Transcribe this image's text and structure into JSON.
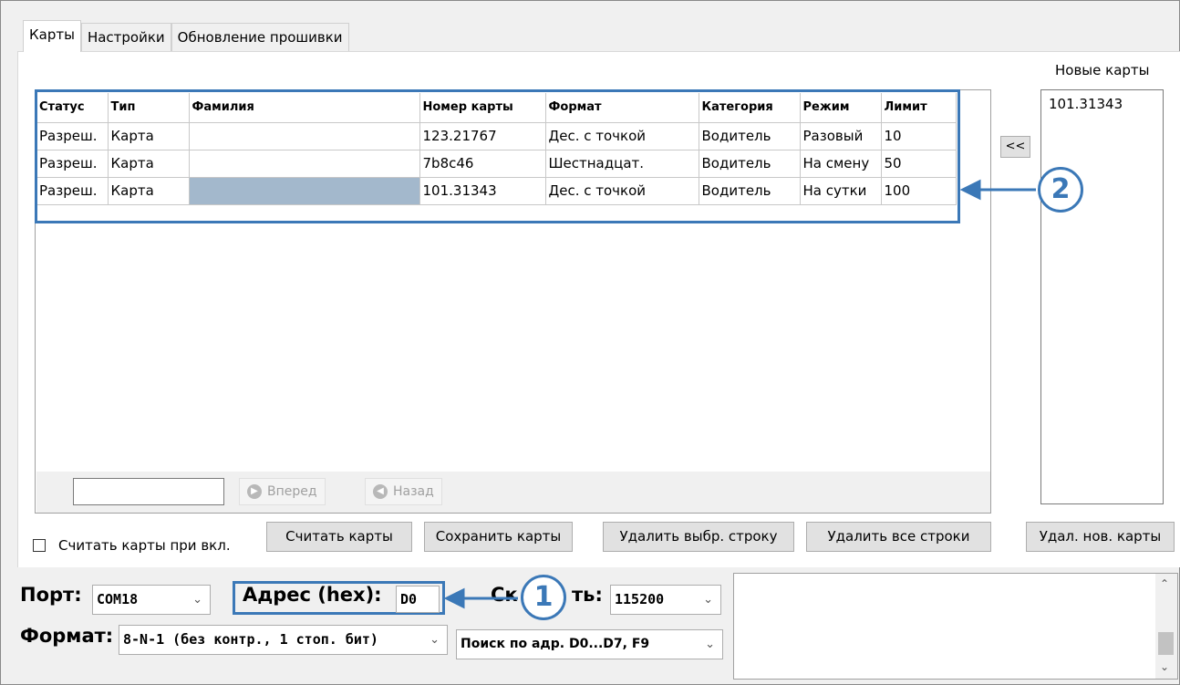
{
  "tabs": [
    {
      "label": "Карты",
      "active": true
    },
    {
      "label": "Настройки",
      "active": false
    },
    {
      "label": "Обновление прошивки",
      "active": false
    }
  ],
  "table": {
    "columns": [
      "Статус",
      "Тип",
      "Фамилия",
      "Номер карты",
      "Формат",
      "Категория",
      "Режим",
      "Лимит"
    ],
    "rows": [
      [
        "Разреш.",
        "Карта",
        "",
        "123.21767",
        "Дес. с точкой",
        "Водитель",
        "Разовый",
        "10"
      ],
      [
        "Разреш.",
        "Карта",
        "",
        "7b8c46",
        "Шестнадцат.",
        "Водитель",
        "На смену",
        "50"
      ],
      [
        "Разреш.",
        "Карта",
        "",
        "101.31343",
        "Дес. с точкой",
        "Водитель",
        "На сутки",
        "100"
      ]
    ]
  },
  "nav": {
    "search_value": "",
    "forward_label": "Вперед",
    "back_label": "Назад"
  },
  "new_cards": {
    "title": "Новые карты",
    "items": [
      "101.31343"
    ],
    "move_button": "<<"
  },
  "buttons": {
    "read_on_start_label": "Считать карты при вкл.",
    "read": "Считать карты",
    "save": "Сохранить карты",
    "delete_selected": "Удалить выбр. строку",
    "delete_all": "Удалить все строки",
    "delete_new": "Удал. нов. карты"
  },
  "settings": {
    "port_label": "Порт:",
    "port_value": "COM18",
    "address_label": "Адрес (hex):",
    "address_value": "D0",
    "speed_label": "Ск",
    "speed_label_tail": "ть:",
    "speed_value": "115200",
    "format_label": "Формат:",
    "format_value": "8-N-1 (без контр., 1 стоп. бит)",
    "search_value": "Поиск по адр. D0...D7, F9"
  },
  "annotations": {
    "badge1": "1",
    "badge2": "2",
    "accent_color": "#3b78b7"
  }
}
